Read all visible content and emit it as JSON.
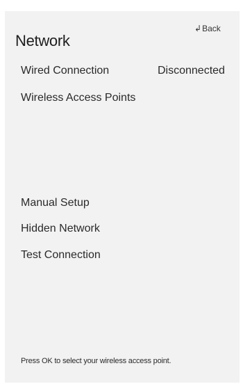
{
  "header": {
    "title": "Network",
    "back_label": "Back"
  },
  "menu": {
    "items": [
      {
        "label": "Wired Connection",
        "status": "Disconnected"
      },
      {
        "label": "Wireless Access Points"
      },
      {
        "label": "Manual Setup"
      },
      {
        "label": "Hidden Network"
      },
      {
        "label": "Test Connection"
      }
    ]
  },
  "footer": {
    "hint": "Press OK to select your wireless access point."
  },
  "colors": {
    "panel_background": "#f2f2f2",
    "text": "#2a2a2a"
  },
  "icons": {
    "back": "back-arrow-icon"
  }
}
